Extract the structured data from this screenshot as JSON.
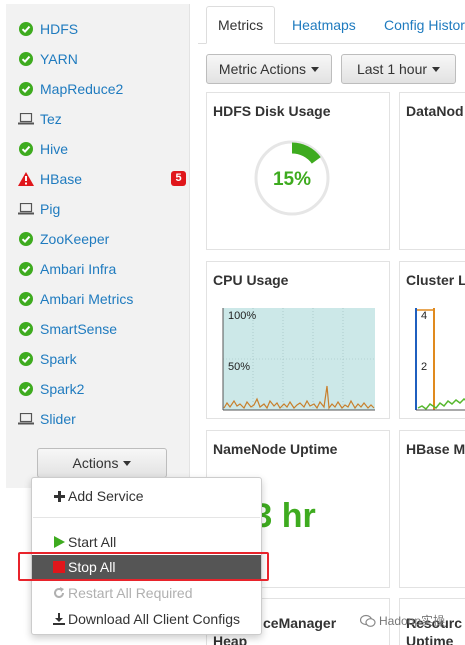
{
  "sidebar": {
    "services": [
      {
        "name": "HDFS",
        "status": "ok"
      },
      {
        "name": "YARN",
        "status": "ok"
      },
      {
        "name": "MapReduce2",
        "status": "ok"
      },
      {
        "name": "Tez",
        "status": "client"
      },
      {
        "name": "Hive",
        "status": "ok"
      },
      {
        "name": "HBase",
        "status": "alert",
        "badge": "5"
      },
      {
        "name": "Pig",
        "status": "client"
      },
      {
        "name": "ZooKeeper",
        "status": "ok"
      },
      {
        "name": "Ambari Infra",
        "status": "ok"
      },
      {
        "name": "Ambari Metrics",
        "status": "ok"
      },
      {
        "name": "SmartSense",
        "status": "ok"
      },
      {
        "name": "Spark",
        "status": "ok"
      },
      {
        "name": "Spark2",
        "status": "ok"
      },
      {
        "name": "Slider",
        "status": "client"
      }
    ],
    "actions_label": "Actions"
  },
  "actions_menu": {
    "add_service": "Add Service",
    "start_all": "Start All",
    "stop_all": "Stop All",
    "restart_all": "Restart All Required",
    "download_configs": "Download All Client Configs"
  },
  "tabs": [
    "Metrics",
    "Heatmaps",
    "Config Histor"
  ],
  "toolbar": {
    "metric_actions": "Metric Actions",
    "time_range": "Last 1 hour"
  },
  "widgets": {
    "hdfs_disk": {
      "title": "HDFS Disk Usage",
      "value": "15%",
      "percent": 15
    },
    "datanode": {
      "title": "DataNod"
    },
    "cpu": {
      "title": "CPU Usage",
      "label_100": "100%",
      "label_50": "50%"
    },
    "cluster": {
      "title": "Cluster L",
      "label_4": "4",
      "label_2": "2"
    },
    "namenode_uptime": {
      "title": "NameNode Uptime",
      "value": "9.3 hr"
    },
    "hbase": {
      "title": "HBase M"
    },
    "resourcemanager": {
      "title": "ceManager",
      "subtitle": "Heap"
    },
    "resource2": {
      "title": "Resourc",
      "subtitle": "Uptime"
    }
  },
  "colors": {
    "ok": "#3eab1f",
    "alert": "#e0161b",
    "link": "#1f7bbf",
    "cpu_fill": "#cce8e8",
    "highlight": "#e8232b"
  },
  "watermark": "Hadoop实操"
}
